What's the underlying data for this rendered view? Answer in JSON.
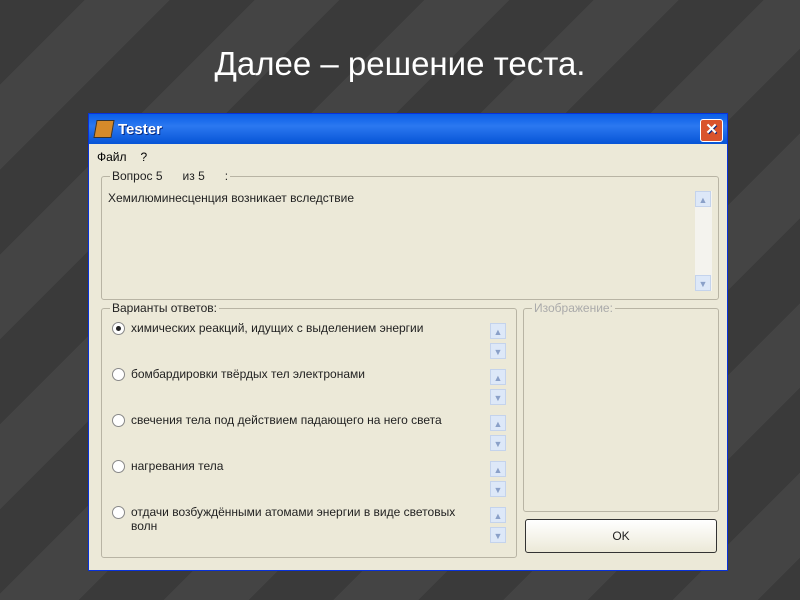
{
  "slide": {
    "title": "Далее – решение теста."
  },
  "window": {
    "title": "Tester",
    "close": "✕"
  },
  "menu": [
    "Файл",
    "?"
  ],
  "question": {
    "legend": "Вопрос 5      из 5      :",
    "text": "Хемилюминесценция возникает вследствие"
  },
  "answers": {
    "legend": "Варианты ответов:",
    "selected": 0,
    "options": [
      "химических реакций, идущих с выделением энергии",
      "бомбардировки твёрдых тел электронами",
      "свечения тела под действием падающего на него света",
      "нагревания тела",
      "отдачи возбуждёнными атомами энергии в виде световых волн"
    ]
  },
  "image": {
    "legend": "Изображение:"
  },
  "ok": "OK"
}
